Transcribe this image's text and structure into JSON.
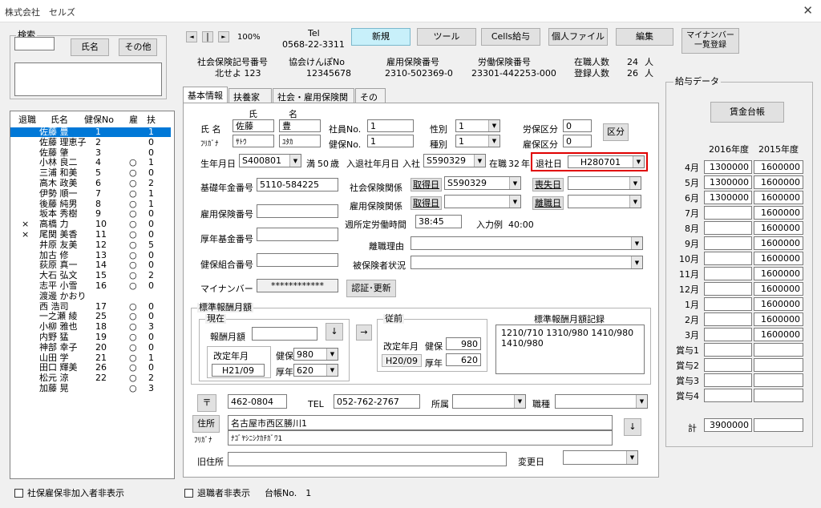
{
  "window": {
    "title": "株式会社　セルズ",
    "close": "✕"
  },
  "search": {
    "group": "検索",
    "name_btn": "氏名",
    "other_btn": "その他"
  },
  "employee_list": {
    "headers": {
      "retired": "退職",
      "name": "氏名",
      "kenpo": "健保No",
      "koyo": "雇",
      "fuyo": "扶"
    },
    "rows": [
      {
        "ret": "",
        "name": "佐藤 豊",
        "no": "1",
        "koyo": "",
        "fuyo": "1",
        "sel": true
      },
      {
        "ret": "",
        "name": "佐藤 理恵子",
        "no": "2",
        "koyo": "",
        "fuyo": "0"
      },
      {
        "ret": "",
        "name": "佐藤 肇",
        "no": "3",
        "koyo": "",
        "fuyo": "0"
      },
      {
        "ret": "",
        "name": "小林 良二",
        "no": "4",
        "koyo": "○",
        "fuyo": "1"
      },
      {
        "ret": "",
        "name": "三浦 和美",
        "no": "5",
        "koyo": "○",
        "fuyo": "0"
      },
      {
        "ret": "",
        "name": "高木 政美",
        "no": "6",
        "koyo": "○",
        "fuyo": "2"
      },
      {
        "ret": "",
        "name": "伊勢 順一",
        "no": "7",
        "koyo": "○",
        "fuyo": "1"
      },
      {
        "ret": "",
        "name": "後藤 純男",
        "no": "8",
        "koyo": "○",
        "fuyo": "1"
      },
      {
        "ret": "",
        "name": "坂本 秀樹",
        "no": "9",
        "koyo": "○",
        "fuyo": "0"
      },
      {
        "ret": "×",
        "name": "高橋 力",
        "no": "10",
        "koyo": "○",
        "fuyo": "0"
      },
      {
        "ret": "×",
        "name": "尾関 美香",
        "no": "11",
        "koyo": "○",
        "fuyo": "0"
      },
      {
        "ret": "",
        "name": "井原 友美",
        "no": "12",
        "koyo": "○",
        "fuyo": "5"
      },
      {
        "ret": "",
        "name": "加古 修",
        "no": "13",
        "koyo": "○",
        "fuyo": "0"
      },
      {
        "ret": "",
        "name": "荻原 真一",
        "no": "14",
        "koyo": "○",
        "fuyo": "0"
      },
      {
        "ret": "",
        "name": "大石 弘文",
        "no": "15",
        "koyo": "○",
        "fuyo": "2"
      },
      {
        "ret": "",
        "name": "志平 小雪",
        "no": "16",
        "koyo": "○",
        "fuyo": "0"
      },
      {
        "ret": "",
        "name": "渡邊 かおり",
        "no": "",
        "koyo": "",
        "fuyo": ""
      },
      {
        "ret": "",
        "name": "西 浩司",
        "no": "17",
        "koyo": "○",
        "fuyo": "0"
      },
      {
        "ret": "",
        "name": "一之瀬 綾",
        "no": "25",
        "koyo": "○",
        "fuyo": "0"
      },
      {
        "ret": "",
        "name": "小柳 雅也",
        "no": "18",
        "koyo": "○",
        "fuyo": "3"
      },
      {
        "ret": "",
        "name": "内野 猛",
        "no": "19",
        "koyo": "○",
        "fuyo": "0"
      },
      {
        "ret": "",
        "name": "神部 幸子",
        "no": "20",
        "koyo": "○",
        "fuyo": "0"
      },
      {
        "ret": "",
        "name": "山田 学",
        "no": "21",
        "koyo": "○",
        "fuyo": "1"
      },
      {
        "ret": "",
        "name": "田口 輝美",
        "no": "26",
        "koyo": "○",
        "fuyo": "0"
      },
      {
        "ret": "",
        "name": "松元 涼",
        "no": "22",
        "koyo": "○",
        "fuyo": "2"
      },
      {
        "ret": "",
        "name": "加藤 晃",
        "no": "",
        "koyo": "○",
        "fuyo": "3"
      }
    ]
  },
  "bottom": {
    "hide_uninsured": "社保雇保非加入者非表示",
    "hide_retired": "退職者非表示",
    "ledger_no": "台帳No.　1"
  },
  "nav": {
    "first": "◄",
    "prev": "|",
    "next": "►",
    "zoom": "100%"
  },
  "company": {
    "tel_label": "Tel",
    "tel": "0568-22-3311"
  },
  "toolbar": {
    "new": "新規",
    "tool": "ツール",
    "cells": "Cells給与",
    "personal_file": "個人ファイル",
    "edit": "編集",
    "mynumber_list": "マイナンバー\n一覧登録"
  },
  "numbers": {
    "shaho_label": "社会保険記号番号",
    "shaho": "北せよ 123",
    "kyokai_label": "協会けんぽNo",
    "kyokai": "12345678",
    "koyo_label": "雇用保険番号",
    "koyo": "2310-502369-0",
    "rodo_label": "労働保険番号",
    "rodo": "23301-442253-000",
    "zaishoku_label": "在職人数",
    "zaishoku": "24",
    "toroku_label": "登録人数",
    "toroku": "26",
    "unit": "人"
  },
  "tabs": [
    "基本情報",
    "扶養家族",
    "社会・雇用保険関係",
    "その他"
  ],
  "basic": {
    "sei_header": "氏",
    "mei_header": "名",
    "name_label": "氏 名",
    "sei": "佐藤",
    "mei": "豊",
    "kana_label": "ﾌﾘｶﾞﾅ",
    "sei_kana": "ｻﾄｳ",
    "mei_kana": "ﾕﾀｶ",
    "shain_label": "社員No.",
    "shain": "1",
    "kenpo_label": "健保No.",
    "kenpo": "1",
    "seibetsu_label": "性別",
    "seibetsu": "1",
    "shubetsu_label": "種別",
    "shubetsu": "1",
    "rouho_label": "労保区分",
    "rouho": "0",
    "koho_label": "雇保区分",
    "koho": "0",
    "kubun_btn": "区分",
    "birth_label": "生年月日",
    "birth": "S400801",
    "age_prefix": "満",
    "age": "50",
    "age_suffix": "歳",
    "nyutai_label": "入退社年月日",
    "nyusha_label": "入社",
    "nyusha": "S590329",
    "zaishoku_prefix": "在職",
    "zaishoku_years": "32",
    "zaishoku_suffix": "年",
    "taisha_label": "退社日",
    "taisha": "H280701",
    "kiso_label": "基礎年金番号",
    "kiso": "5110-584225",
    "shakai_label": "社会保険関係",
    "shutoku_btn": "取得日",
    "shakai_shutoku": "S590329",
    "soshitsu_btn": "喪失日",
    "shakai_soshitsu": "",
    "koyo_kankei_label": "雇用保険関係",
    "koyo_shutoku_btn": "取得日",
    "koyo_shutoku": "",
    "rishoku_btn": "離職日",
    "koyo_rishoku": "",
    "koyohoken_label": "雇用保険番号",
    "shotei_label": "週所定労働時間",
    "shotei": "38:45",
    "example_label": "入力例",
    "example": "40:00",
    "kosei_label": "厚年基金番号",
    "rishoku_riyu_label": "離職理由",
    "hihoken_label": "被保険者状況",
    "kenpo_kumiai_label": "健保組合番号",
    "mynumber_label": "マイナンバー",
    "mynumber": "************",
    "auth_btn": "認証･更新"
  },
  "hyojun": {
    "group": "標準報酬月額",
    "genzai": "現在",
    "hoshu_label": "報酬月額",
    "down_btn": "↓",
    "kaitei_label": "改定年月",
    "kaitei": "H21/09",
    "kenpo_label": "健保",
    "kenpo": "980",
    "kounen_label": "厚年",
    "kounen": "620",
    "arrow_btn": "→",
    "juzen": "従前",
    "juzen_kaitei_label": "改定年月",
    "juzen_kaitei": "H20/09",
    "juzen_kenpo_label": "健保",
    "juzen_kenpo": "980",
    "juzen_kounen_label": "厚年",
    "juzen_kounen": "620",
    "kiroku_label": "標準報酬月額記録",
    "kiroku": "1210/710  1310/980 1410/980\n1410/980"
  },
  "address": {
    "zip_btn": "〒",
    "zip": "462-0804",
    "tel_label": "TEL",
    "tel": "052-762-2767",
    "shozoku_label": "所属",
    "shozoku": "",
    "shokushu_label": "職種",
    "shokushu": "",
    "jusho_btn": "住所",
    "jusho": "名古屋市西区勝川1",
    "kana_label": "ﾌﾘｶﾞﾅ",
    "jusho_kana": "ﾅｺﾞﾔｼﾆｼｸｶﾁｶﾞﾜ1",
    "down_btn": "↓",
    "kyu_label": "旧住所",
    "kyu": "",
    "henko_label": "変更日",
    "henko": ""
  },
  "salary": {
    "group": "給与データ",
    "ledger_btn": "賃金台帳",
    "year1": "2016年度",
    "year2": "2015年度",
    "rows": [
      {
        "m": "4月",
        "a": "1300000",
        "b": "1600000"
      },
      {
        "m": "5月",
        "a": "1300000",
        "b": "1600000"
      },
      {
        "m": "6月",
        "a": "1300000",
        "b": "1600000"
      },
      {
        "m": "7月",
        "a": "",
        "b": "1600000"
      },
      {
        "m": "8月",
        "a": "",
        "b": "1600000"
      },
      {
        "m": "9月",
        "a": "",
        "b": "1600000"
      },
      {
        "m": "10月",
        "a": "",
        "b": "1600000"
      },
      {
        "m": "11月",
        "a": "",
        "b": "1600000"
      },
      {
        "m": "12月",
        "a": "",
        "b": "1600000"
      },
      {
        "m": "1月",
        "a": "",
        "b": "1600000"
      },
      {
        "m": "2月",
        "a": "",
        "b": "1600000"
      },
      {
        "m": "3月",
        "a": "",
        "b": "1600000"
      },
      {
        "m": "賞与1",
        "a": "",
        "b": ""
      },
      {
        "m": "賞与2",
        "a": "",
        "b": ""
      },
      {
        "m": "賞与3",
        "a": "",
        "b": ""
      },
      {
        "m": "賞与4",
        "a": "",
        "b": ""
      }
    ],
    "total_label": "計",
    "total_a": "3900000",
    "total_b": ""
  }
}
